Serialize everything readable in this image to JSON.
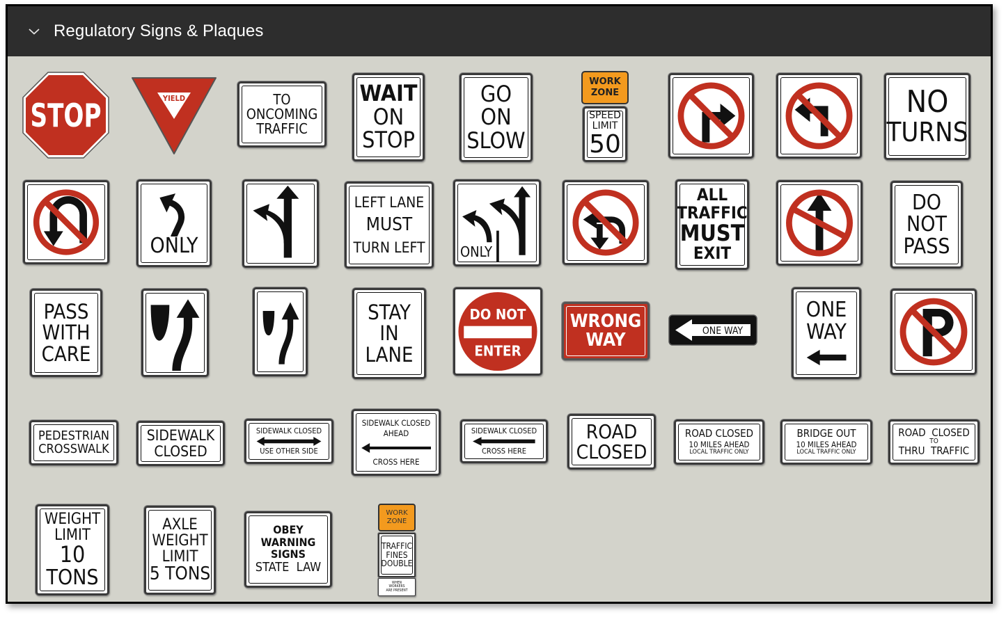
{
  "panel": {
    "title": "Regulatory Signs & Plaques",
    "collapse_icon": "chevron-down-icon",
    "colors": {
      "header_bg": "#2d2d2d",
      "panel_bg": "#d3d3cb",
      "sign_red": "#c03020",
      "work_zone_orange": "#f39a1e"
    }
  },
  "signs": {
    "stop": {
      "label": "STOP"
    },
    "yield": {
      "label": "YIELD"
    },
    "to_oncoming": {
      "lines": [
        "TO",
        "ONCOMING",
        "TRAFFIC"
      ]
    },
    "wait_on_stop": {
      "lines": [
        "WAIT",
        "ON",
        "STOP"
      ]
    },
    "go_on_slow": {
      "lines": [
        "GO",
        "ON",
        "SLOW"
      ]
    },
    "work_zone_speed": {
      "top": [
        "WORK",
        "ZONE"
      ],
      "lines": [
        "SPEED",
        "LIMIT"
      ],
      "value": "50"
    },
    "no_right_turn": {
      "icon": "no-right-turn-icon"
    },
    "no_left_turn": {
      "icon": "no-left-turn-icon"
    },
    "no_turns": {
      "lines": [
        "NO",
        "TURNS"
      ]
    },
    "no_u_turn": {
      "icon": "no-u-turn-icon"
    },
    "left_only": {
      "label": "ONLY"
    },
    "left_or_through": {
      "icon": "left-or-through-arrow-icon"
    },
    "left_lane_must": {
      "lines": [
        "LEFT LANE",
        "MUST",
        "TURN LEFT"
      ]
    },
    "two_lane_only": {
      "label": "ONLY"
    },
    "no_left_u_turn": {
      "icon": "no-left-and-u-turn-icon"
    },
    "all_traffic_exit": {
      "lines": [
        "ALL",
        "TRAFFIC",
        "MUST",
        "EXIT"
      ]
    },
    "no_straight": {
      "icon": "no-straight-through-icon"
    },
    "do_not_pass": {
      "lines": [
        "DO",
        "NOT",
        "PASS"
      ]
    },
    "pass_with_care": {
      "lines": [
        "PASS",
        "WITH",
        "CARE"
      ]
    },
    "keep_right": {
      "icon": "keep-right-icon"
    },
    "keep_right_narrow": {
      "icon": "keep-right-narrow-icon"
    },
    "stay_in_lane": {
      "lines": [
        "STAY",
        "IN",
        "LANE"
      ]
    },
    "do_not_enter": {
      "lines": [
        "DO NOT",
        "ENTER"
      ]
    },
    "wrong_way": {
      "lines": [
        "WRONG",
        "WAY"
      ]
    },
    "one_way_horizontal": {
      "label": "ONE WAY"
    },
    "one_way_vertical": {
      "lines": [
        "ONE",
        "WAY"
      ]
    },
    "no_parking": {
      "icon": "no-parking-icon"
    },
    "pedestrian_crosswalk": {
      "lines": [
        "PEDESTRIAN",
        "CROSSWALK"
      ]
    },
    "sidewalk_closed": {
      "lines": [
        "SIDEWALK",
        "CLOSED"
      ]
    },
    "sidewalk_use_other": {
      "lines": [
        "SIDEWALK CLOSED",
        "USE OTHER SIDE"
      ]
    },
    "sidewalk_ahead": {
      "lines": [
        "SIDEWALK CLOSED",
        "AHEAD",
        "CROSS HERE"
      ]
    },
    "sidewalk_cross_here": {
      "lines": [
        "SIDEWALK CLOSED",
        "CROSS HERE"
      ]
    },
    "road_closed": {
      "lines": [
        "ROAD",
        "CLOSED"
      ]
    },
    "road_closed_miles": {
      "lines": [
        "ROAD CLOSED",
        "10 MILES AHEAD",
        "LOCAL TRAFFIC ONLY"
      ]
    },
    "bridge_out": {
      "lines": [
        "BRIDGE OUT",
        "10 MILES AHEAD",
        "LOCAL TRAFFIC ONLY"
      ]
    },
    "road_closed_thru": {
      "lines": [
        "ROAD  CLOSED",
        "TO",
        "THRU  TRAFFIC"
      ]
    },
    "weight_limit": {
      "lines": [
        "WEIGHT",
        "LIMIT",
        "10",
        "TONS"
      ]
    },
    "axle_weight": {
      "lines": [
        "AXLE",
        "WEIGHT",
        "LIMIT",
        "5 TONS"
      ]
    },
    "obey_warning": {
      "lines": [
        "OBEY",
        "WARNING",
        "SIGNS",
        "STATE  LAW"
      ]
    },
    "work_zone_fines": {
      "top": [
        "WORK",
        "ZONE"
      ],
      "lines": [
        "TRAFFIC",
        "FINES",
        "DOUBLE"
      ],
      "bottom": [
        "WHEN",
        "WORKERS",
        "ARE PRESENT"
      ]
    }
  }
}
